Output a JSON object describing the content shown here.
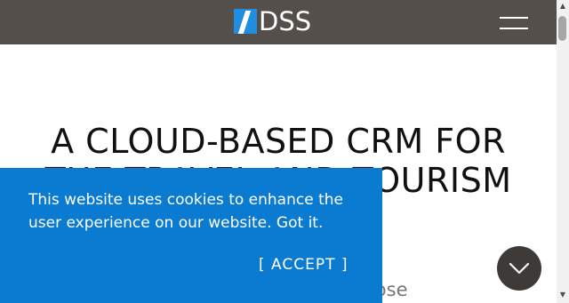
{
  "header": {
    "logo_text": "DSS",
    "menu_icon": "hamburger-menu-icon"
  },
  "hero": {
    "title": "A CLOUD-BASED CRM FOR THE TRAVEL AND TOURISM",
    "subtitle_partial": "e world choose"
  },
  "cookie_banner": {
    "message": "This website uses cookies to enhance the user experience on our website. Got it.",
    "accept_label": "[ ACCEPT ]"
  },
  "scroll_button": {
    "icon": "chevron-down-icon"
  },
  "colors": {
    "header_bg": "#544f4b",
    "logo_accent": "#1f8de0",
    "cookie_bg": "#0a7bd0",
    "scroll_btn_bg": "#3d3a38"
  }
}
